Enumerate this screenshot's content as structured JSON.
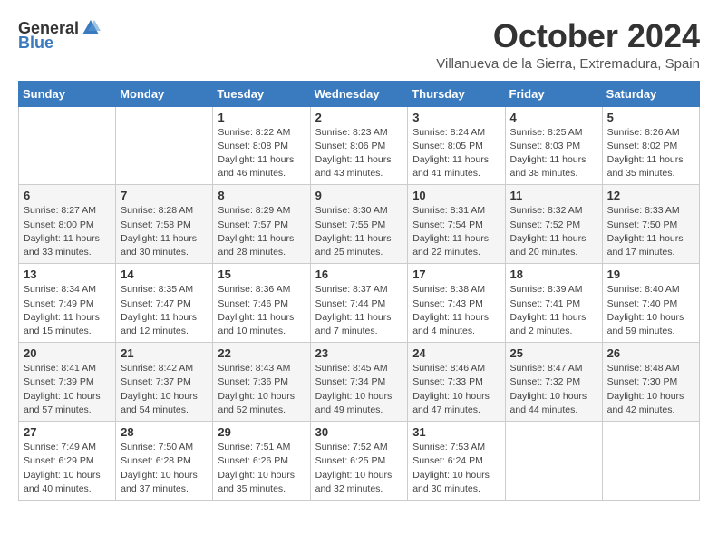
{
  "header": {
    "logo_general": "General",
    "logo_blue": "Blue",
    "month": "October 2024",
    "location": "Villanueva de la Sierra, Extremadura, Spain"
  },
  "weekdays": [
    "Sunday",
    "Monday",
    "Tuesday",
    "Wednesday",
    "Thursday",
    "Friday",
    "Saturday"
  ],
  "weeks": [
    [
      {
        "day": "",
        "info": ""
      },
      {
        "day": "",
        "info": ""
      },
      {
        "day": "1",
        "info": "Sunrise: 8:22 AM\nSunset: 8:08 PM\nDaylight: 11 hours and 46 minutes."
      },
      {
        "day": "2",
        "info": "Sunrise: 8:23 AM\nSunset: 8:06 PM\nDaylight: 11 hours and 43 minutes."
      },
      {
        "day": "3",
        "info": "Sunrise: 8:24 AM\nSunset: 8:05 PM\nDaylight: 11 hours and 41 minutes."
      },
      {
        "day": "4",
        "info": "Sunrise: 8:25 AM\nSunset: 8:03 PM\nDaylight: 11 hours and 38 minutes."
      },
      {
        "day": "5",
        "info": "Sunrise: 8:26 AM\nSunset: 8:02 PM\nDaylight: 11 hours and 35 minutes."
      }
    ],
    [
      {
        "day": "6",
        "info": "Sunrise: 8:27 AM\nSunset: 8:00 PM\nDaylight: 11 hours and 33 minutes."
      },
      {
        "day": "7",
        "info": "Sunrise: 8:28 AM\nSunset: 7:58 PM\nDaylight: 11 hours and 30 minutes."
      },
      {
        "day": "8",
        "info": "Sunrise: 8:29 AM\nSunset: 7:57 PM\nDaylight: 11 hours and 28 minutes."
      },
      {
        "day": "9",
        "info": "Sunrise: 8:30 AM\nSunset: 7:55 PM\nDaylight: 11 hours and 25 minutes."
      },
      {
        "day": "10",
        "info": "Sunrise: 8:31 AM\nSunset: 7:54 PM\nDaylight: 11 hours and 22 minutes."
      },
      {
        "day": "11",
        "info": "Sunrise: 8:32 AM\nSunset: 7:52 PM\nDaylight: 11 hours and 20 minutes."
      },
      {
        "day": "12",
        "info": "Sunrise: 8:33 AM\nSunset: 7:50 PM\nDaylight: 11 hours and 17 minutes."
      }
    ],
    [
      {
        "day": "13",
        "info": "Sunrise: 8:34 AM\nSunset: 7:49 PM\nDaylight: 11 hours and 15 minutes."
      },
      {
        "day": "14",
        "info": "Sunrise: 8:35 AM\nSunset: 7:47 PM\nDaylight: 11 hours and 12 minutes."
      },
      {
        "day": "15",
        "info": "Sunrise: 8:36 AM\nSunset: 7:46 PM\nDaylight: 11 hours and 10 minutes."
      },
      {
        "day": "16",
        "info": "Sunrise: 8:37 AM\nSunset: 7:44 PM\nDaylight: 11 hours and 7 minutes."
      },
      {
        "day": "17",
        "info": "Sunrise: 8:38 AM\nSunset: 7:43 PM\nDaylight: 11 hours and 4 minutes."
      },
      {
        "day": "18",
        "info": "Sunrise: 8:39 AM\nSunset: 7:41 PM\nDaylight: 11 hours and 2 minutes."
      },
      {
        "day": "19",
        "info": "Sunrise: 8:40 AM\nSunset: 7:40 PM\nDaylight: 10 hours and 59 minutes."
      }
    ],
    [
      {
        "day": "20",
        "info": "Sunrise: 8:41 AM\nSunset: 7:39 PM\nDaylight: 10 hours and 57 minutes."
      },
      {
        "day": "21",
        "info": "Sunrise: 8:42 AM\nSunset: 7:37 PM\nDaylight: 10 hours and 54 minutes."
      },
      {
        "day": "22",
        "info": "Sunrise: 8:43 AM\nSunset: 7:36 PM\nDaylight: 10 hours and 52 minutes."
      },
      {
        "day": "23",
        "info": "Sunrise: 8:45 AM\nSunset: 7:34 PM\nDaylight: 10 hours and 49 minutes."
      },
      {
        "day": "24",
        "info": "Sunrise: 8:46 AM\nSunset: 7:33 PM\nDaylight: 10 hours and 47 minutes."
      },
      {
        "day": "25",
        "info": "Sunrise: 8:47 AM\nSunset: 7:32 PM\nDaylight: 10 hours and 44 minutes."
      },
      {
        "day": "26",
        "info": "Sunrise: 8:48 AM\nSunset: 7:30 PM\nDaylight: 10 hours and 42 minutes."
      }
    ],
    [
      {
        "day": "27",
        "info": "Sunrise: 7:49 AM\nSunset: 6:29 PM\nDaylight: 10 hours and 40 minutes."
      },
      {
        "day": "28",
        "info": "Sunrise: 7:50 AM\nSunset: 6:28 PM\nDaylight: 10 hours and 37 minutes."
      },
      {
        "day": "29",
        "info": "Sunrise: 7:51 AM\nSunset: 6:26 PM\nDaylight: 10 hours and 35 minutes."
      },
      {
        "day": "30",
        "info": "Sunrise: 7:52 AM\nSunset: 6:25 PM\nDaylight: 10 hours and 32 minutes."
      },
      {
        "day": "31",
        "info": "Sunrise: 7:53 AM\nSunset: 6:24 PM\nDaylight: 10 hours and 30 minutes."
      },
      {
        "day": "",
        "info": ""
      },
      {
        "day": "",
        "info": ""
      }
    ]
  ]
}
